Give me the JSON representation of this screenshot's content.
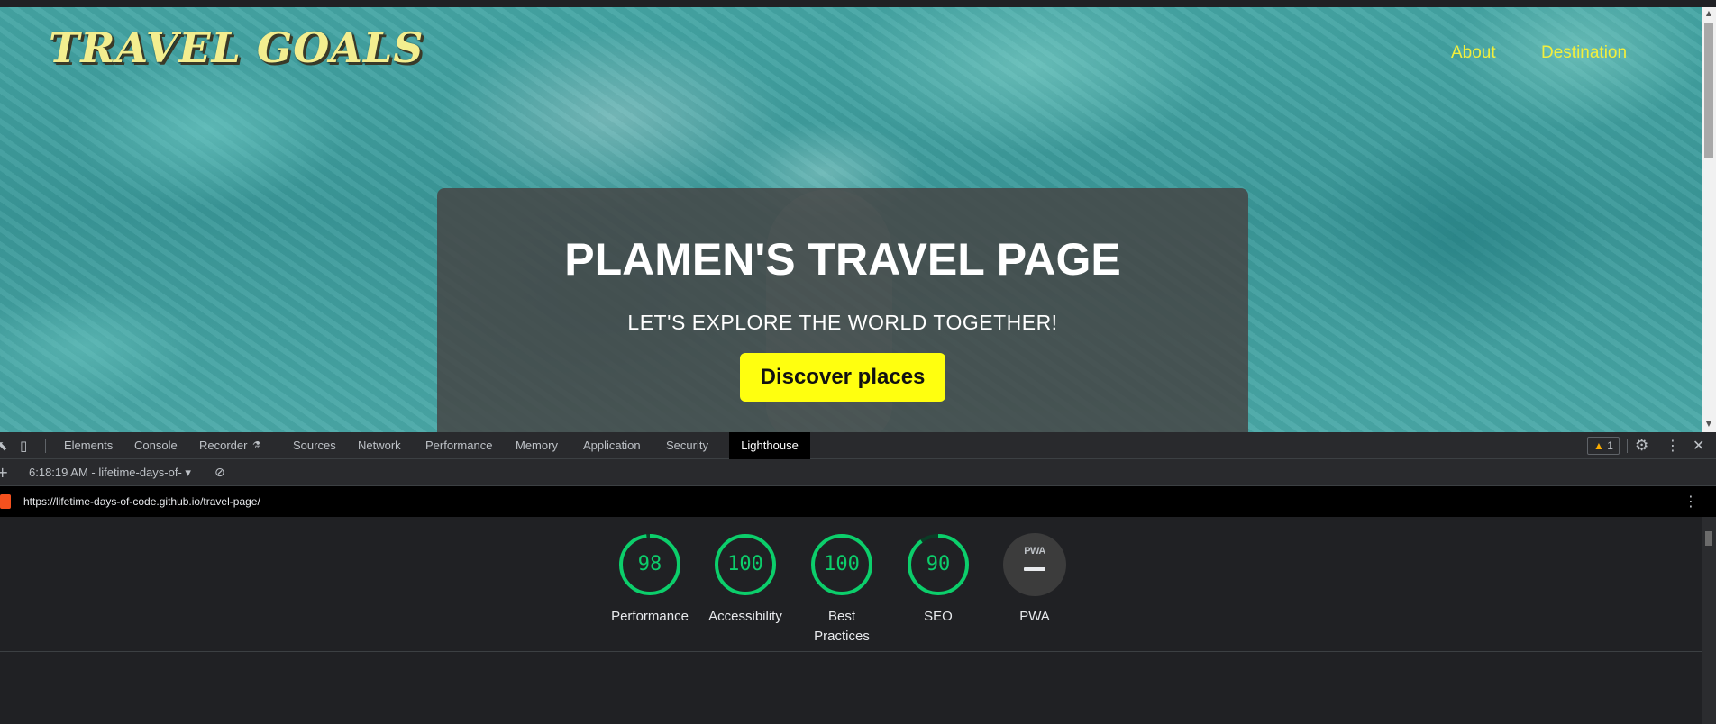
{
  "site": {
    "logo": "TRAVEL GOALS",
    "nav": {
      "about": "About",
      "destination": "Destination"
    },
    "hero": {
      "title": "PLAMEN'S TRAVEL PAGE",
      "subtitle": "LET'S EXPLORE THE WORLD TOGETHER!",
      "button": "Discover places"
    }
  },
  "devtools": {
    "tabs": [
      "Elements",
      "Console",
      "Recorder",
      "Sources",
      "Network",
      "Performance",
      "Memory",
      "Application",
      "Security",
      "Lighthouse"
    ],
    "active_tab": "Lighthouse",
    "warning_count": "1",
    "report_select": "6:18:19 AM - lifetime-days-of-",
    "url": "https://lifetime-days-of-code.github.io/travel-page/",
    "scores": [
      {
        "label": "Performance",
        "value": "98",
        "score": 98
      },
      {
        "label": "Accessibility",
        "value": "100",
        "score": 100
      },
      {
        "label": "Best Practices",
        "value": "100",
        "score": 100
      },
      {
        "label": "SEO",
        "value": "90",
        "score": 90
      }
    ],
    "pwa": {
      "label": "PWA",
      "badge": "PWA"
    },
    "colors": {
      "pass": "#0cce6b",
      "pass_track": "#0a3d26"
    }
  }
}
